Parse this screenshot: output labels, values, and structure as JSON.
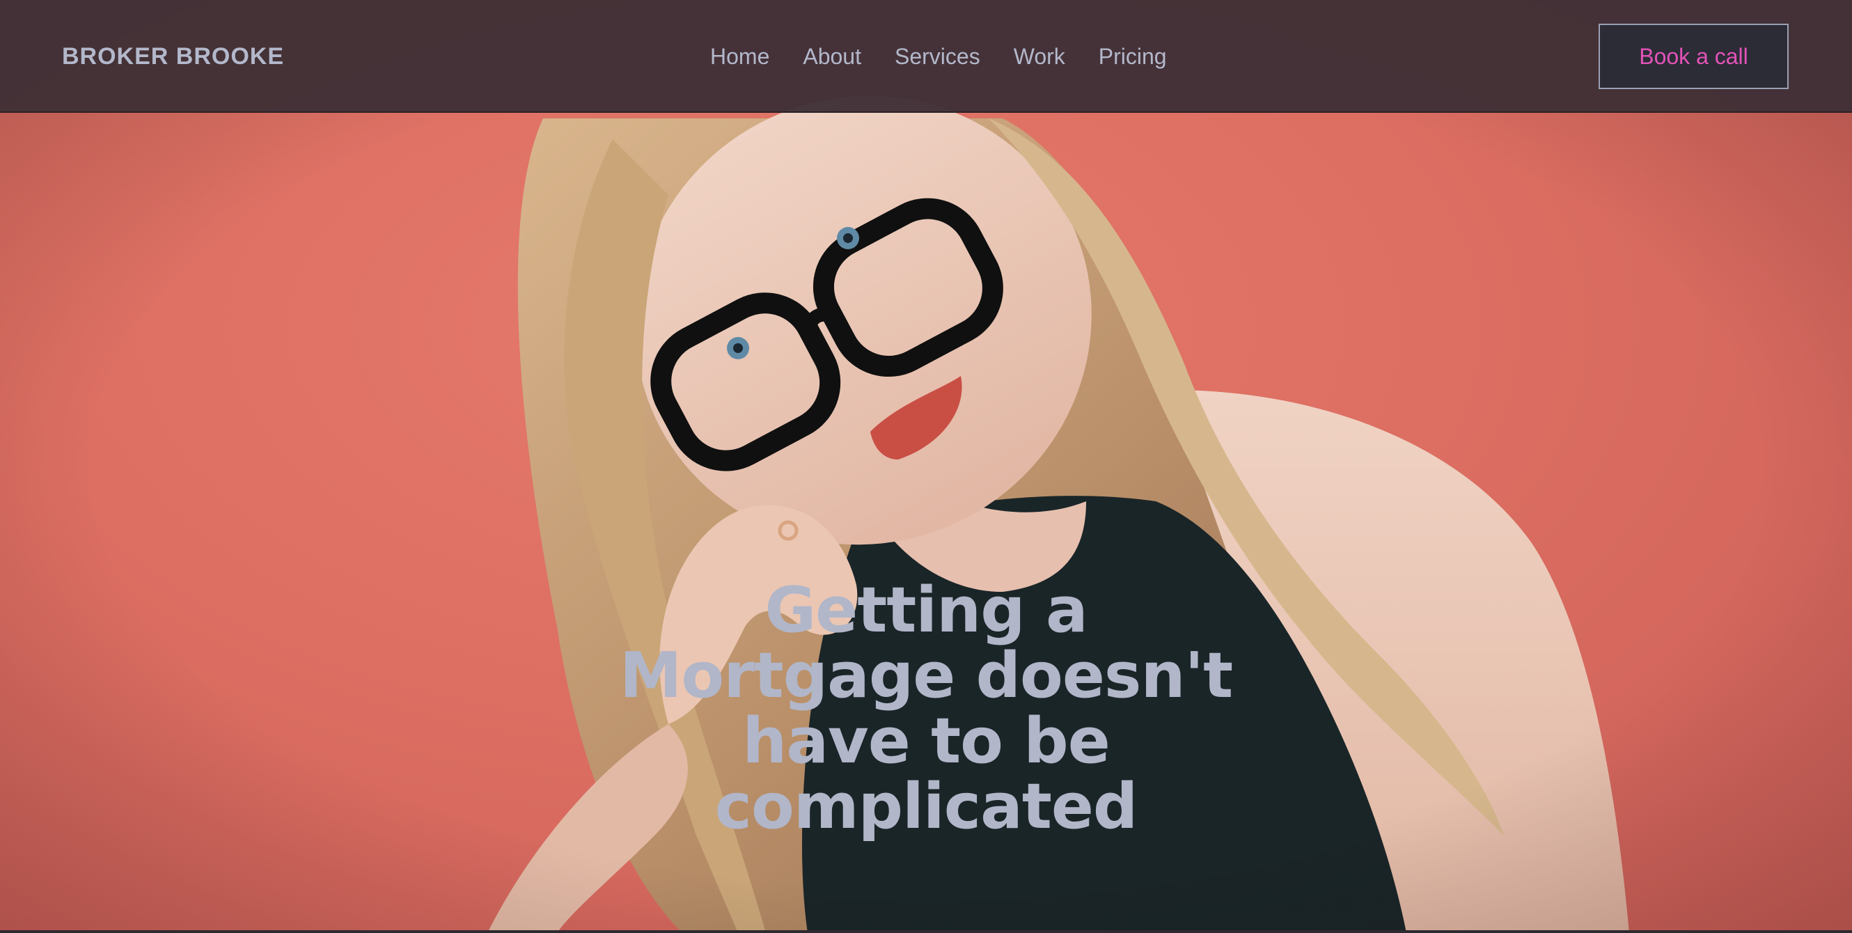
{
  "brand": {
    "name": "BROKER BROOKE"
  },
  "nav": {
    "items": [
      {
        "label": "Home"
      },
      {
        "label": "About"
      },
      {
        "label": "Services"
      },
      {
        "label": "Work"
      },
      {
        "label": "Pricing"
      }
    ],
    "cta_label": "Book a call"
  },
  "hero": {
    "headline_lines": [
      "Getting a",
      "Mortgage doesn't",
      "have to be",
      "complicated"
    ]
  },
  "colors": {
    "nav_background": "#3e3036",
    "nav_text": "#b3b8cb",
    "cta_text": "#e353b8",
    "cta_background": "#2c2c36",
    "hero_background": "#dc6e62",
    "headline_text": "#b1b6c9"
  }
}
